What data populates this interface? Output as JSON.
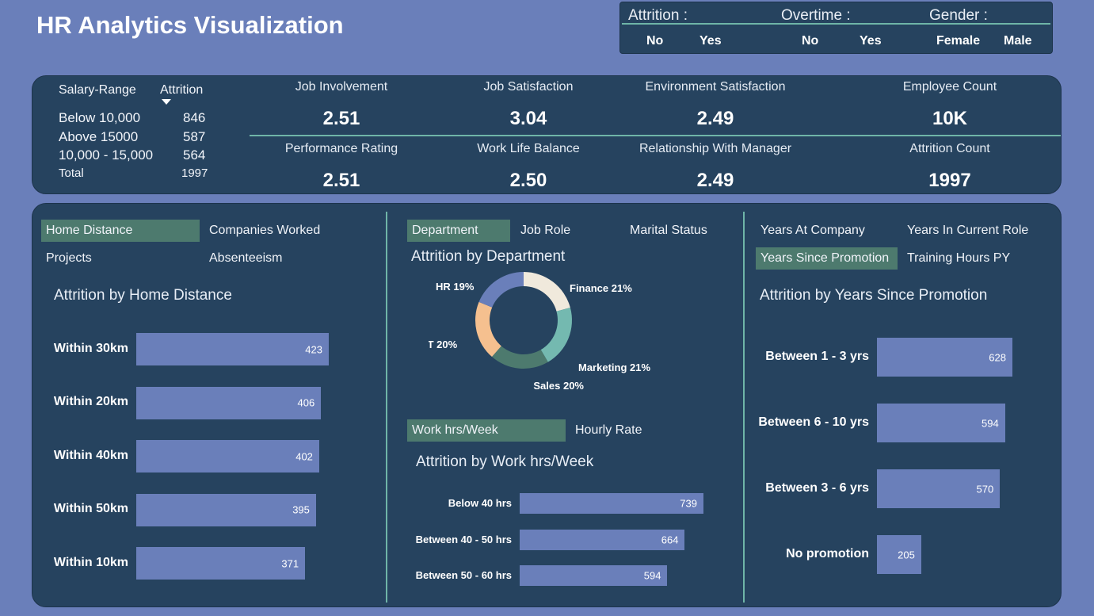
{
  "title": "HR Analytics Visualization",
  "filters": [
    {
      "label": "Attrition :",
      "options": [
        "No",
        "Yes"
      ]
    },
    {
      "label": "Overtime :",
      "options": [
        "No",
        "Yes"
      ]
    },
    {
      "label": "Gender :",
      "options": [
        "Female",
        "Male"
      ]
    }
  ],
  "salary_table": {
    "col1": "Salary-Range",
    "col2": "Attrition",
    "rows": [
      {
        "range": "Below 10,000",
        "value": "846"
      },
      {
        "range": "Above 15000",
        "value": "587"
      },
      {
        "range": "10,000 - 15,000",
        "value": "564"
      }
    ],
    "total_label": "Total",
    "total_value": "1997"
  },
  "kpis": [
    {
      "label": "Job Involvement",
      "value": "2.51"
    },
    {
      "label": "Job Satisfaction",
      "value": "3.04"
    },
    {
      "label": "Environment Satisfaction",
      "value": "2.49"
    },
    {
      "label": "Employee Count",
      "value": "10K"
    },
    {
      "label": "Performance Rating",
      "value": "2.51"
    },
    {
      "label": "Work Life Balance",
      "value": "2.50"
    },
    {
      "label": "Relationship With Manager",
      "value": "2.49"
    },
    {
      "label": "Attrition Count",
      "value": "1997"
    }
  ],
  "left_section": {
    "tabs": [
      "Home Distance",
      "Companies Worked",
      "Projects",
      "Absenteeism"
    ],
    "active_tab": "Home Distance"
  },
  "middle_section": {
    "tabs": [
      "Department",
      "Job Role",
      "Marital Status"
    ],
    "active_tab": "Department",
    "tabs2": [
      "Work hrs/Week",
      "Hourly Rate"
    ],
    "active_tab2": "Work hrs/Week"
  },
  "right_section": {
    "tabs": [
      "Years At Company",
      "Years In Current Role",
      "Years Since Promotion",
      "Training Hours PY"
    ],
    "active_tab": "Years Since Promotion"
  },
  "colors": {
    "background": "#6a7fba",
    "panel": "#26435f",
    "accent_line": "#6fb5a8",
    "active_tab": "#4d7a6e",
    "bar": "#6a7fba"
  },
  "chart_data": [
    {
      "type": "bar",
      "orientation": "horizontal",
      "title": "Attrition by Home Distance",
      "categories": [
        "Within 30km",
        "Within 20km",
        "Within 40km",
        "Within 50km",
        "Within 10km"
      ],
      "values": [
        423,
        406,
        402,
        395,
        371
      ]
    },
    {
      "type": "pie",
      "style": "donut",
      "title": "Attrition by Department",
      "categories": [
        "Finance",
        "Marketing",
        "Sales",
        "IT",
        "HR"
      ],
      "values": [
        21,
        21,
        20,
        20,
        19
      ],
      "labels": [
        "Finance 21%",
        "Marketing 21%",
        "Sales 20%",
        "IT 20%",
        "HR 19%"
      ],
      "colors": [
        "#f0e9dc",
        "#74b9b0",
        "#4d7a6e",
        "#f5c08f",
        "#6a7fba"
      ]
    },
    {
      "type": "bar",
      "orientation": "horizontal",
      "title": "Attrition by Work hrs/Week",
      "categories": [
        "Below 40 hrs",
        "Between 40 - 50 hrs",
        "Between 50 - 60 hrs"
      ],
      "values": [
        739,
        664,
        594
      ]
    },
    {
      "type": "bar",
      "orientation": "horizontal",
      "title": "Attrition by Years Since Promotion",
      "categories": [
        "Between 1 - 3 yrs",
        "Between 6 - 10 yrs",
        "Between 3 - 6 yrs",
        "No promotion"
      ],
      "values": [
        628,
        594,
        570,
        205
      ]
    }
  ]
}
